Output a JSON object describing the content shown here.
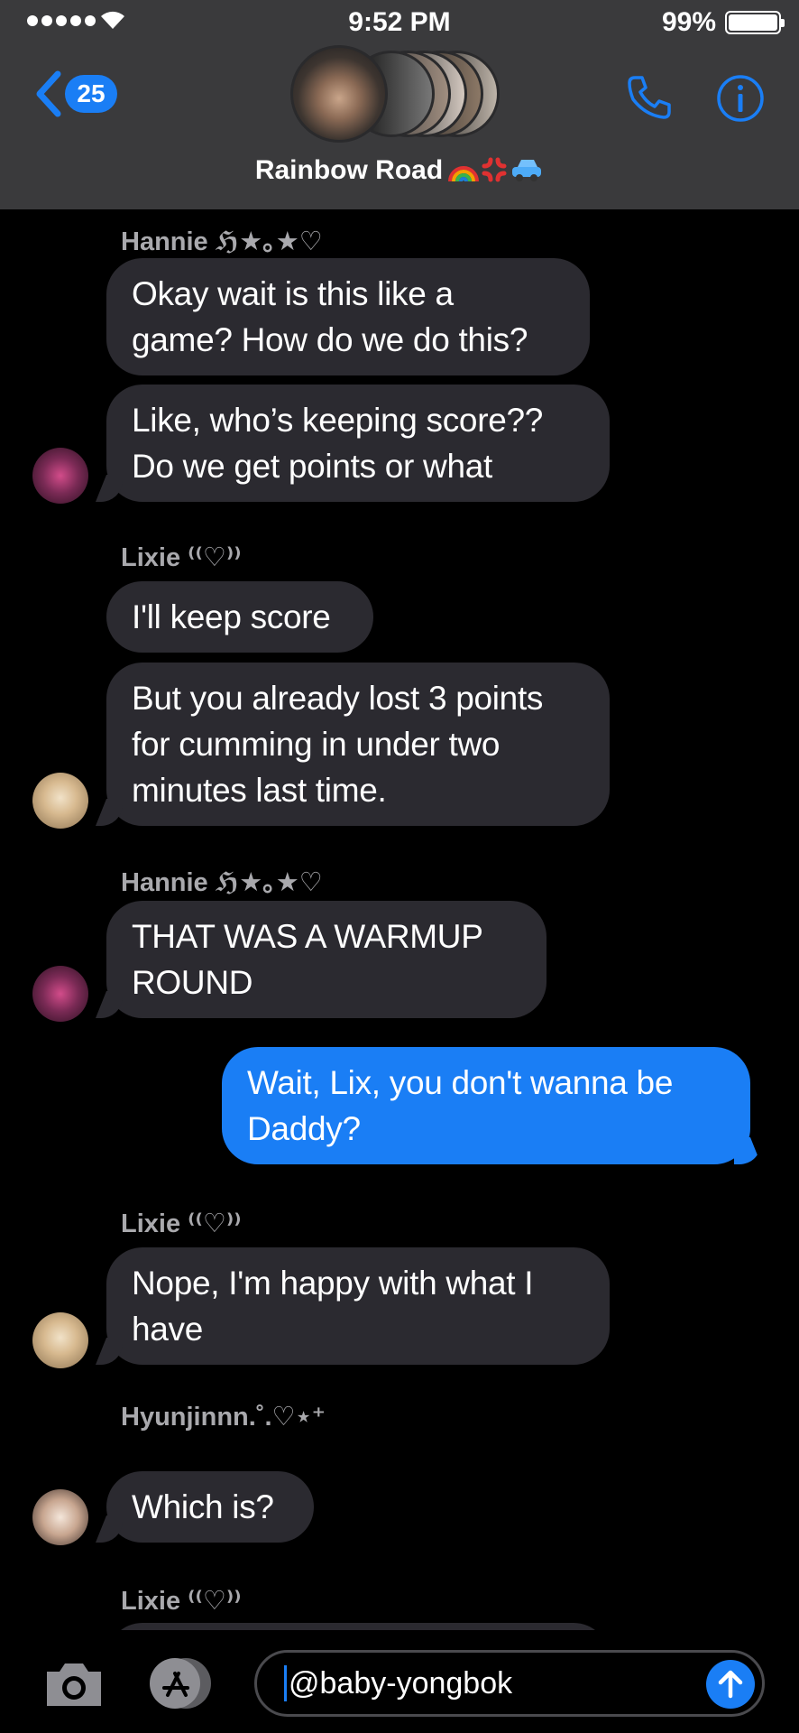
{
  "status_bar": {
    "time": "9:52 PM",
    "battery": "99%"
  },
  "header": {
    "unread_count": "25",
    "group_name": "Rainbow Road"
  },
  "messages": [
    {
      "sender": "Hannie ℌ★｡★♡"
    },
    {
      "text_1": "Okay wait is this like a",
      "text_2": "game? How do we do this?"
    },
    {
      "text_1": "Like, who’s keeping score??",
      "text_2": "Do we get points or what"
    },
    {
      "sender": "Lixie ⁽⁽♡⁾⁾"
    },
    {
      "text_1": "I'll keep score"
    },
    {
      "text_1": "But you already lost 3 points",
      "text_2": "for cumming in under two",
      "text_3": "minutes last time."
    },
    {
      "sender": "Hannie ℌ★｡★♡"
    },
    {
      "text_1": "THAT WAS A WARMUP",
      "text_2": "ROUND"
    },
    {
      "text_1": "Wait, Lix, you don't wanna be",
      "text_2": "Daddy?"
    },
    {
      "sender": "Lixie ⁽⁽♡⁾⁾"
    },
    {
      "text_1": "Nope, I'm happy with what I",
      "text_2": "have"
    },
    {
      "sender": "Hyunjinnn.˚.♡⋆⁺"
    },
    {
      "text_1": "Which is?"
    },
    {
      "sender": "Lixie ⁽⁽♡⁾⁾"
    }
  ],
  "input": {
    "value": "@baby-yongbok"
  },
  "colors": {
    "accent": "#1a7ef5",
    "incoming_bubble": "#2b2a30",
    "header_bg": "#3a3a3c"
  }
}
